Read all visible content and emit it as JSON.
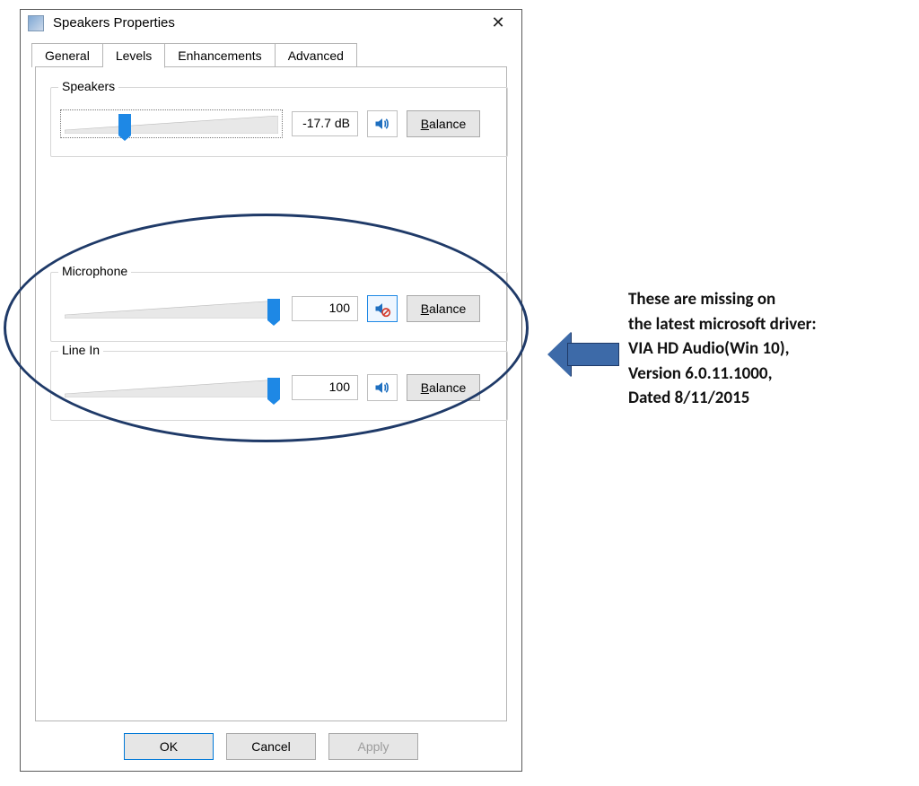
{
  "window": {
    "title": "Speakers Properties",
    "close_tooltip": "Close"
  },
  "tabs": {
    "general": "General",
    "levels": "Levels",
    "enhancements": "Enhancements",
    "advanced": "Advanced",
    "active": "levels"
  },
  "groups": {
    "speakers": {
      "label": "Speakers",
      "value": "-17.7 dB",
      "slider_pos_pct": 26,
      "muted": false,
      "balance": "Balance"
    },
    "microphone": {
      "label": "Microphone",
      "value": "100",
      "slider_pos_pct": 100,
      "muted": true,
      "balance": "Balance"
    },
    "linein": {
      "label": "Line In",
      "value": "100",
      "slider_pos_pct": 100,
      "muted": false,
      "balance": "Balance"
    }
  },
  "buttons": {
    "ok": "OK",
    "cancel": "Cancel",
    "apply": "Apply"
  },
  "annotation": {
    "line1": "These are missing on",
    "line2": "the latest microsoft driver:",
    "line3": "VIA HD Audio(Win 10),",
    "line4": "Version 6.0.11.1000,",
    "line5": "Dated 8/11/2015"
  }
}
